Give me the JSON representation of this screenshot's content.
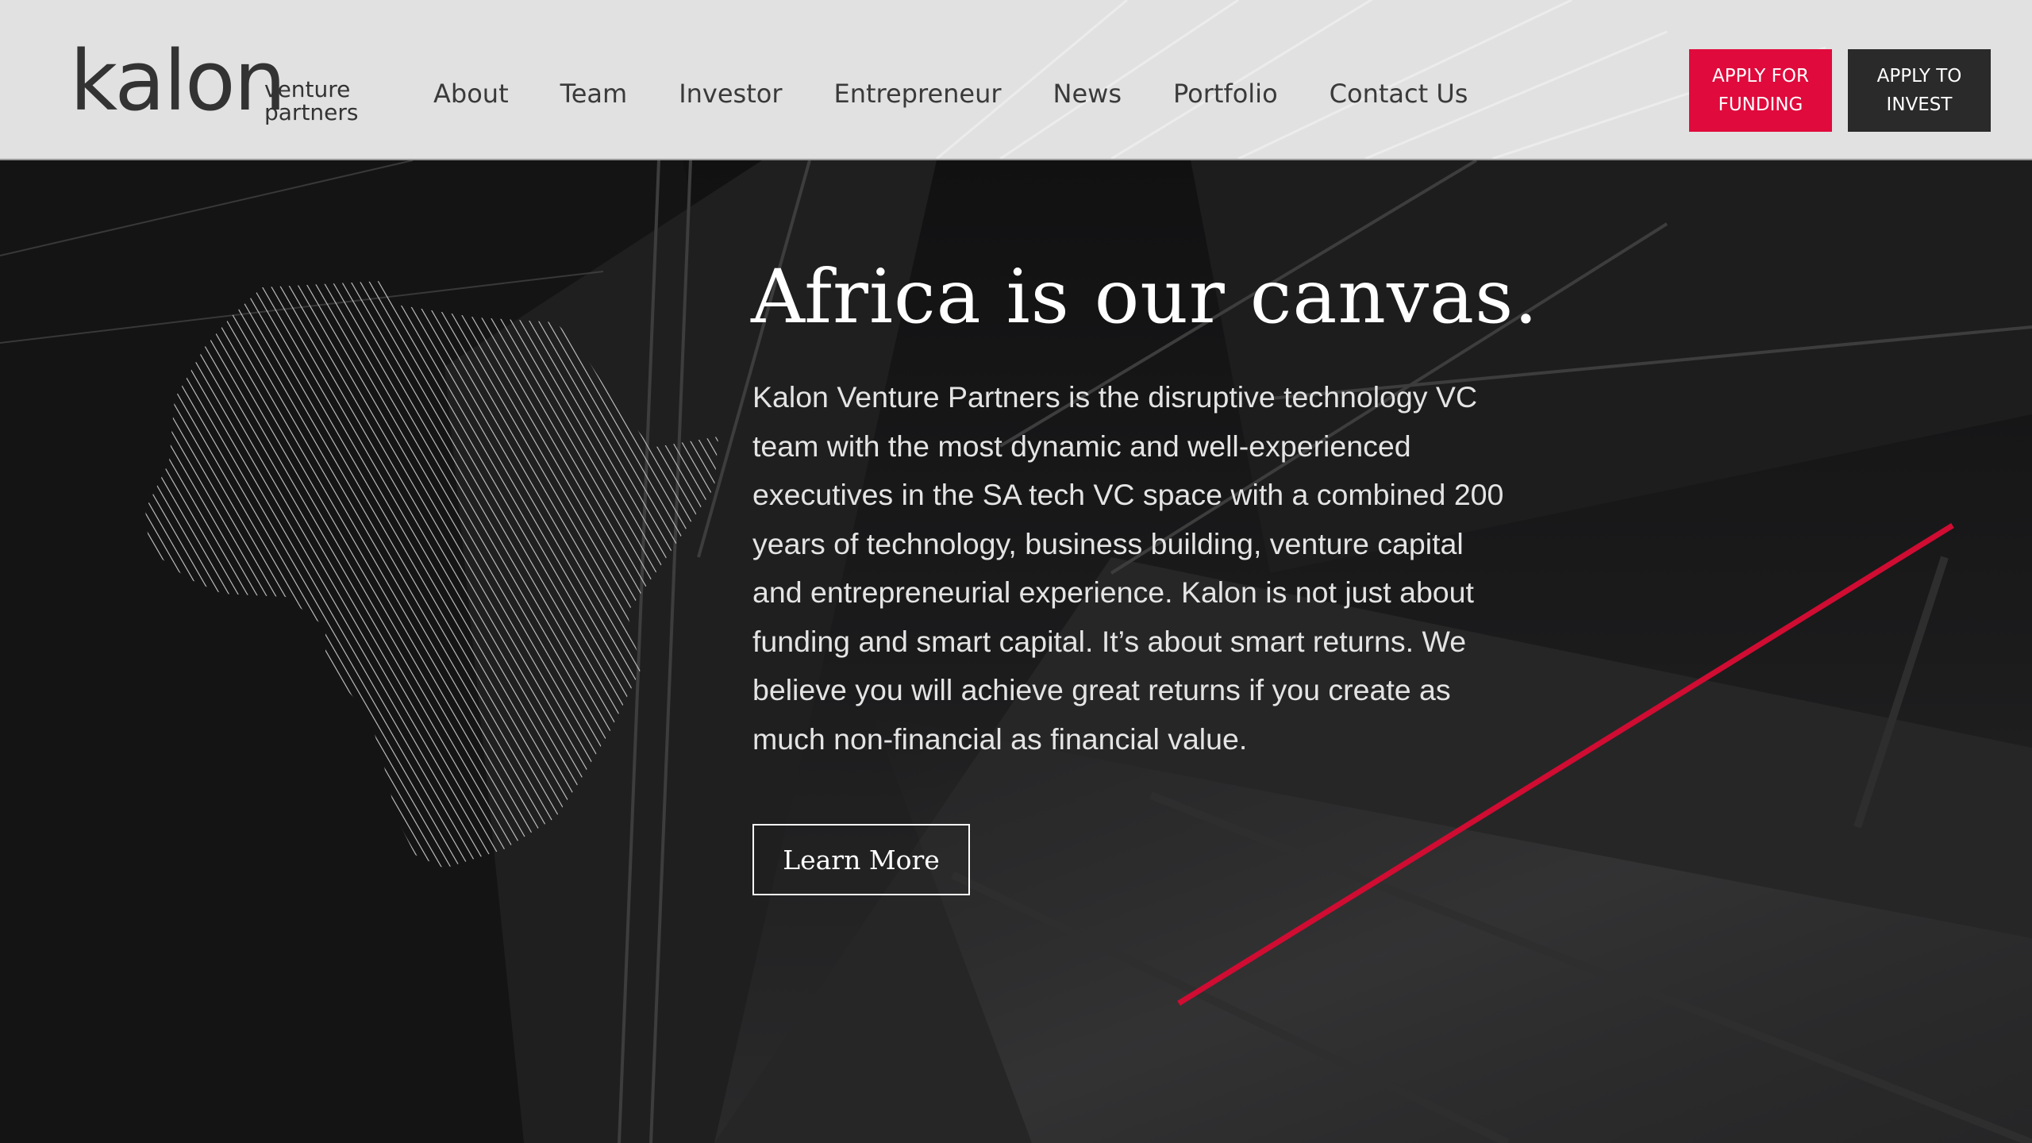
{
  "brand": {
    "logo_word": "kalon",
    "logo_sub_line1": "venture",
    "logo_sub_line2": "partners"
  },
  "nav": {
    "items": [
      {
        "label": "About"
      },
      {
        "label": "Team"
      },
      {
        "label": "Investor"
      },
      {
        "label": "Entrepreneur"
      },
      {
        "label": "News"
      },
      {
        "label": "Portfolio"
      },
      {
        "label": "Contact Us"
      }
    ]
  },
  "cta": {
    "funding_line1": "APPLY FOR",
    "funding_line2": "FUNDING",
    "invest_line1": "APPLY TO",
    "invest_line2": "INVEST"
  },
  "hero": {
    "title": "Africa is our canvas.",
    "body": "Kalon Venture Partners is the disruptive technology VC team with the most dynamic and well-experienced executives in the SA tech VC space with a combined 200 years of technology, business building, venture capital and entrepreneurial experience. Kalon is not just about funding and smart capital. It’s about smart returns. We believe you will achieve great returns if you create as much non-financial as financial value.",
    "button_label": "Learn More"
  },
  "colors": {
    "accent_red": "#e00a3c",
    "dark_button": "#2a2a2b",
    "header_bg": "#e1e1e1",
    "hero_bg": "#1a1a1b"
  }
}
